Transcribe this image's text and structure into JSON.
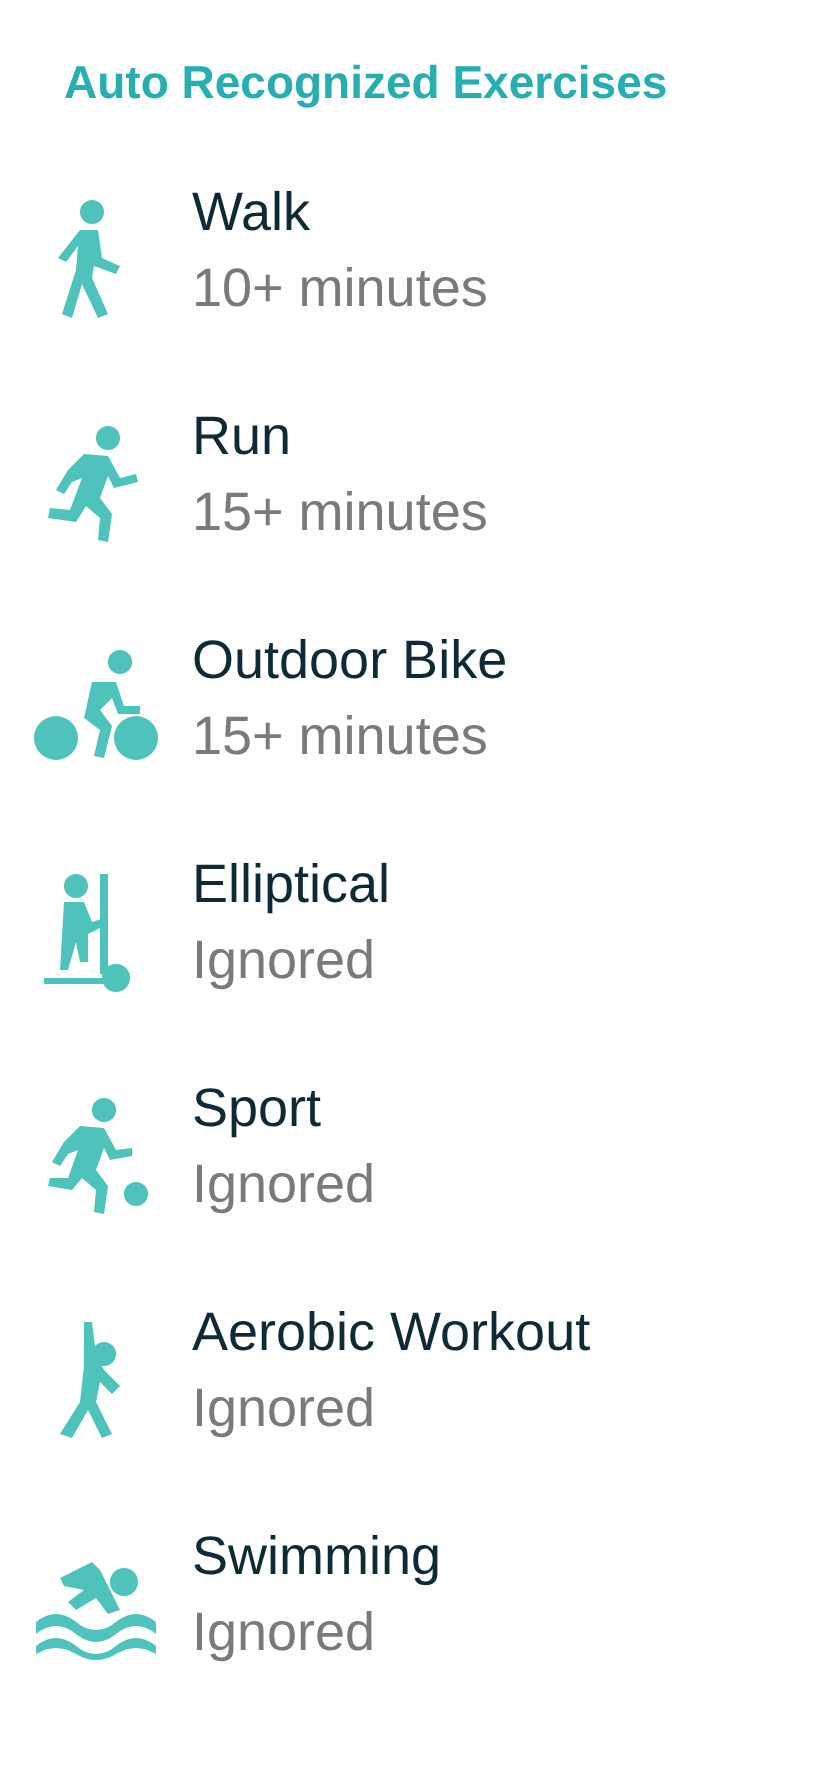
{
  "title": "Auto Recognized Exercises",
  "exercises": [
    {
      "name": "Walk",
      "detail": "10+ minutes"
    },
    {
      "name": "Run",
      "detail": "15+ minutes"
    },
    {
      "name": "Outdoor Bike",
      "detail": "15+ minutes"
    },
    {
      "name": "Elliptical",
      "detail": "Ignored"
    },
    {
      "name": "Sport",
      "detail": "Ignored"
    },
    {
      "name": "Aerobic Workout",
      "detail": "Ignored"
    },
    {
      "name": "Swimming",
      "detail": "Ignored"
    }
  ]
}
